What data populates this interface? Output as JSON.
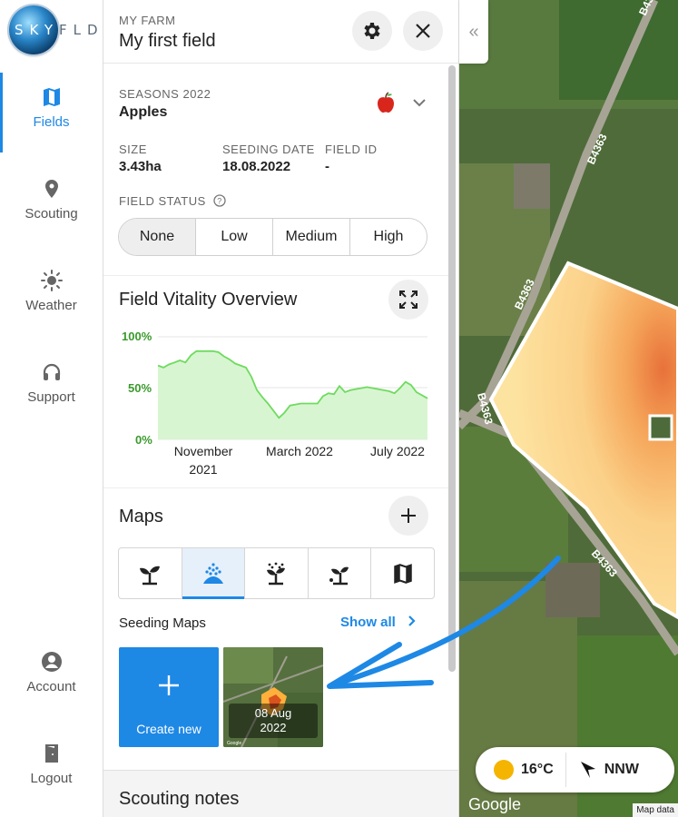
{
  "brand": {
    "logo_text_1": "SKY",
    "logo_text_2": "FLD"
  },
  "nav": {
    "fields": "Fields",
    "scouting": "Scouting",
    "weather": "Weather",
    "support": "Support",
    "account": "Account",
    "logout": "Logout"
  },
  "header": {
    "farm_label": "MY FARM",
    "field_name": "My first field"
  },
  "season": {
    "label": "SEASONS 2022",
    "crop": "Apples",
    "crop_icon": "apple-icon"
  },
  "stats": {
    "size_label": "SIZE",
    "size_value": "3.43ha",
    "seeding_label": "SEEDING DATE",
    "seeding_value": "18.08.2022",
    "field_id_label": "FIELD ID",
    "field_id_value": "-"
  },
  "status": {
    "label": "FIELD STATUS",
    "options": [
      "None",
      "Low",
      "Medium",
      "High"
    ],
    "selected": "None"
  },
  "vitality": {
    "title": "Field Vitality Overview"
  },
  "chart_data": {
    "type": "area",
    "title": "Field Vitality Overview",
    "x_tick_labels": [
      "November 2021",
      "March 2022",
      "July 2022"
    ],
    "y_tick_labels": [
      "100%",
      "50%",
      "0%"
    ],
    "ylim": [
      0,
      100
    ],
    "x": [
      0,
      2,
      4,
      6,
      8,
      10,
      12,
      14,
      16,
      18,
      20,
      22,
      24,
      26,
      28,
      30,
      32,
      34,
      36,
      38,
      40,
      42,
      44,
      46,
      48,
      50,
      52,
      54,
      56
    ],
    "values": [
      72,
      70,
      73,
      75,
      77,
      75,
      82,
      86,
      86,
      86,
      86,
      85,
      81,
      78,
      74,
      72,
      70,
      61,
      48,
      41,
      35,
      28,
      21,
      26,
      33,
      34,
      35,
      35,
      35
    ],
    "values_tail_x": [
      58,
      60,
      62,
      64,
      66,
      68,
      70,
      72,
      74,
      76,
      78,
      80,
      82,
      84,
      86,
      88,
      90,
      92,
      94,
      96,
      98
    ],
    "values_tail": [
      35,
      42,
      45,
      44,
      52,
      46,
      48,
      49,
      50,
      51,
      50,
      49,
      48,
      47,
      45,
      50,
      56,
      53,
      46,
      43,
      40
    ],
    "grid": true,
    "fill_color": "#d8f5d1",
    "line_color": "#6edb5f"
  },
  "maps": {
    "title": "Maps",
    "tabs": [
      "seedling-icon",
      "irrigation-icon",
      "fertilizer-icon",
      "planting-icon",
      "map-icon"
    ],
    "selected_tab": 1,
    "section_label": "Seeding Maps",
    "show_all": "Show all",
    "create_new": "Create new",
    "thumbnail_date_line1": "08 Aug",
    "thumbnail_date_line2": "2022"
  },
  "scouting": {
    "title": "Scouting notes"
  },
  "map": {
    "road_labels": [
      "B4363",
      "B4363",
      "B4363",
      "B4363"
    ],
    "google": "Google",
    "map_data": "Map data"
  },
  "weather": {
    "temp": "16°C",
    "wind": "NNW"
  }
}
